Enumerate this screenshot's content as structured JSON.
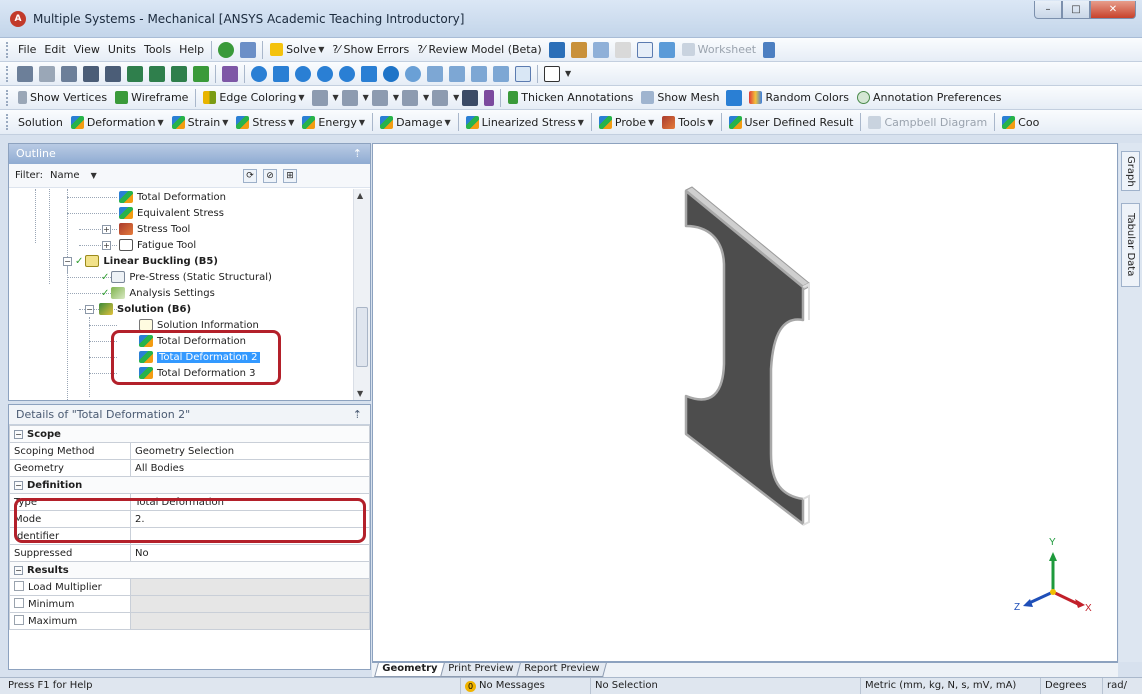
{
  "window": {
    "title": "Multiple Systems - Mechanical [ANSYS Academic Teaching Introductory]",
    "app_icon": "ansys-logo",
    "min": "–",
    "max": "□",
    "close": "✕"
  },
  "menu": {
    "items": [
      "File",
      "Edit",
      "View",
      "Units",
      "Tools",
      "Help"
    ],
    "solve": "Solve",
    "show_errors": "?⁄ Show Errors",
    "review_model": "?⁄ Review Model (Beta)",
    "worksheet": "Worksheet"
  },
  "annotation_bar": {
    "show_vertices": "Show Vertices",
    "wireframe": "Wireframe",
    "edge_coloring": "Edge Coloring",
    "thicken_annotations": "Thicken Annotations",
    "show_mesh": "Show Mesh",
    "random_colors": "Random Colors",
    "annotation_preferences": "Annotation Preferences"
  },
  "solution_bar": {
    "solution": "Solution",
    "deformation": "Deformation",
    "strain": "Strain",
    "stress": "Stress",
    "energy": "Energy",
    "damage": "Damage",
    "linearized_stress": "Linearized Stress",
    "probe": "Probe",
    "tools": "Tools",
    "user_defined_result": "User Defined Result",
    "campbell_diagram": "Campbell Diagram",
    "coordinate": "Coo"
  },
  "outline": {
    "title": "Outline",
    "filter_label": "Filter:",
    "filter_value": "Name",
    "nodes": {
      "total_deformation_a": "Total Deformation",
      "equivalent_stress": "Equivalent Stress",
      "stress_tool": "Stress Tool",
      "fatigue_tool": "Fatigue Tool",
      "linear_buckling": "Linear Buckling (B5)",
      "pre_stress": "Pre-Stress (Static Structural)",
      "analysis_settings": "Analysis Settings",
      "solution": "Solution (B6)",
      "solution_information": "Solution Information",
      "total_deformation": "Total Deformation",
      "total_deformation_2": "Total Deformation 2",
      "total_deformation_3": "Total Deformation 3"
    }
  },
  "details": {
    "title": "Details of \"Total Deformation 2\"",
    "scope": "Scope",
    "scoping_method_k": "Scoping Method",
    "scoping_method_v": "Geometry Selection",
    "geometry_k": "Geometry",
    "geometry_v": "All Bodies",
    "definition": "Definition",
    "type_k": "Type",
    "type_v": "Total Deformation",
    "mode_k": "Mode",
    "mode_v": "2.",
    "identifier_k": "Identifier",
    "identifier_v": "",
    "suppressed_k": "Suppressed",
    "suppressed_v": "No",
    "results": "Results",
    "load_multiplier": "Load Multiplier",
    "minimum": "Minimum",
    "maximum": "Maximum"
  },
  "viewport": {
    "side_tabs": [
      "Graph",
      "Tabular Data"
    ],
    "triad": {
      "x": "X",
      "y": "Y",
      "z": "Z"
    },
    "tabs": [
      "Geometry",
      "Print Preview",
      "Report Preview"
    ]
  },
  "status": {
    "help": "Press F1 for Help",
    "messages": "No Messages",
    "messages_count": "0",
    "selection": "No Selection",
    "units": "Metric (mm, kg, N, s, mV, mA)",
    "angle": "Degrees",
    "rad": "rad/"
  },
  "colors": {
    "accent": "#3399ff",
    "highlight_box": "#b3202a",
    "panel_header": "#8fabd2",
    "geometry_face": "#4d4d4d",
    "geometry_edge": "#cfcfcf"
  }
}
